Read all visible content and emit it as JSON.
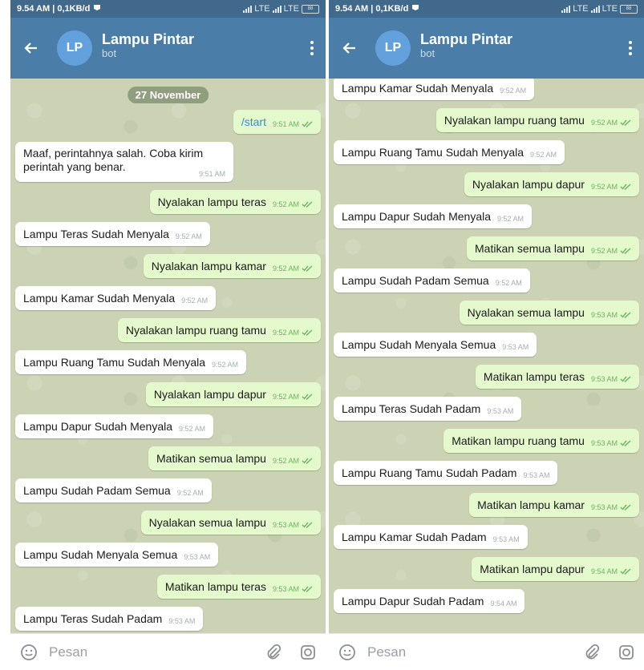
{
  "status_bar": {
    "time_data": "9.54 AM | 0,1KB/d",
    "network": "LTE",
    "network2": "LTE",
    "battery": "88"
  },
  "chat": {
    "title": "Lampu Pintar",
    "subtitle": "bot",
    "avatar_initials": "LP",
    "date_divider": "27 November"
  },
  "input": {
    "placeholder": "Pesan"
  },
  "icons": [
    "back-arrow-icon",
    "more-vert-icon",
    "emoji-icon",
    "attach-icon",
    "camera-icon",
    "double-check-icon"
  ],
  "colors": {
    "header": "#4a7ea9",
    "status_bar": "#40698c",
    "outgoing_bubble": "#e4f9cc",
    "incoming_bubble": "#ffffff",
    "wallpaper": "#cbd3b4",
    "command_link": "#3b8bd2"
  },
  "left_messages": [
    {
      "dir": "out",
      "text": "/start",
      "time": "9:51 AM"
    },
    {
      "dir": "in",
      "text": "Maaf, perintahnya salah. Coba kirim perintah yang benar.",
      "time": "9:51 AM"
    },
    {
      "dir": "out",
      "text": "Nyalakan lampu teras",
      "time": "9:52 AM"
    },
    {
      "dir": "in",
      "text": "Lampu Teras Sudah Menyala",
      "time": "9:52 AM"
    },
    {
      "dir": "out",
      "text": "Nyalakan lampu kamar",
      "time": "9:52 AM"
    },
    {
      "dir": "in",
      "text": "Lampu Kamar Sudah Menyala",
      "time": "9:52 AM"
    },
    {
      "dir": "out",
      "text": "Nyalakan lampu ruang tamu",
      "time": "9:52 AM"
    },
    {
      "dir": "in",
      "text": "Lampu Ruang Tamu Sudah Menyala",
      "time": "9:52 AM"
    },
    {
      "dir": "out",
      "text": "Nyalakan lampu dapur",
      "time": "9:52 AM"
    },
    {
      "dir": "in",
      "text": "Lampu Dapur Sudah Menyala",
      "time": "9:52 AM"
    },
    {
      "dir": "out",
      "text": "Matikan semua lampu",
      "time": "9:52 AM"
    },
    {
      "dir": "in",
      "text": "Lampu Sudah Padam Semua",
      "time": "9:52 AM"
    },
    {
      "dir": "out",
      "text": "Nyalakan semua lampu",
      "time": "9:53 AM"
    },
    {
      "dir": "in",
      "text": "Lampu Sudah Menyala Semua",
      "time": "9:53 AM"
    },
    {
      "dir": "out",
      "text": "Matikan lampu teras",
      "time": "9:53 AM"
    },
    {
      "dir": "in",
      "text": "Lampu Teras Sudah Padam",
      "time": "9:53 AM"
    }
  ],
  "right_messages": [
    {
      "dir": "in",
      "text": "Lampu Kamar Sudah Menyala",
      "time": "9:52 AM"
    },
    {
      "dir": "out",
      "text": "Nyalakan lampu ruang tamu",
      "time": "9:52 AM"
    },
    {
      "dir": "in",
      "text": "Lampu Ruang Tamu Sudah Menyala",
      "time": "9:52 AM"
    },
    {
      "dir": "out",
      "text": "Nyalakan lampu dapur",
      "time": "9:52 AM"
    },
    {
      "dir": "in",
      "text": "Lampu Dapur Sudah Menyala",
      "time": "9:52 AM"
    },
    {
      "dir": "out",
      "text": "Matikan semua lampu",
      "time": "9:52 AM"
    },
    {
      "dir": "in",
      "text": "Lampu Sudah Padam Semua",
      "time": "9:52 AM"
    },
    {
      "dir": "out",
      "text": "Nyalakan semua lampu",
      "time": "9:53 AM"
    },
    {
      "dir": "in",
      "text": "Lampu Sudah Menyala Semua",
      "time": "9:53 AM"
    },
    {
      "dir": "out",
      "text": "Matikan lampu teras",
      "time": "9:53 AM"
    },
    {
      "dir": "in",
      "text": "Lampu Teras Sudah Padam",
      "time": "9:53 AM"
    },
    {
      "dir": "out",
      "text": "Matikan lampu ruang tamu",
      "time": "9:53 AM"
    },
    {
      "dir": "in",
      "text": "Lampu Ruang Tamu Sudah Padam",
      "time": "9:53 AM"
    },
    {
      "dir": "out",
      "text": "Matikan lampu kamar",
      "time": "9:53 AM"
    },
    {
      "dir": "in",
      "text": "Lampu Kamar Sudah Padam",
      "time": "9:53 AM"
    },
    {
      "dir": "out",
      "text": "Matikan lampu dapur",
      "time": "9:54 AM"
    },
    {
      "dir": "in",
      "text": "Lampu Dapur Sudah Padam",
      "time": "9:54 AM"
    }
  ]
}
